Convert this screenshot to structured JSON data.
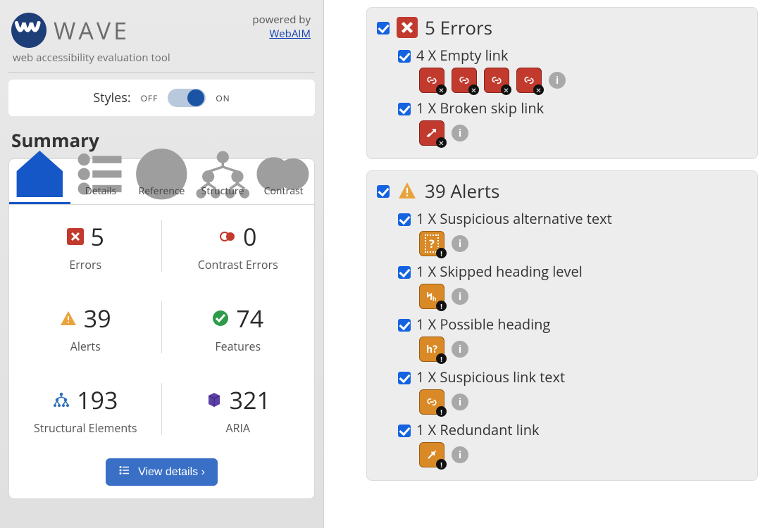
{
  "brand": {
    "title": "WAVE",
    "subtitle": "web accessibility evaluation tool",
    "powered_label": "powered by",
    "powered_link": "WebAIM"
  },
  "styles": {
    "label": "Styles:",
    "off": "OFF",
    "on": "ON"
  },
  "section": {
    "summary": "Summary"
  },
  "tabs": [
    "Summary",
    "Details",
    "Reference",
    "Structure",
    "Contrast"
  ],
  "stats": {
    "errors": {
      "value": "5",
      "label": "Errors"
    },
    "contrast": {
      "value": "0",
      "label": "Contrast Errors"
    },
    "alerts": {
      "value": "39",
      "label": "Alerts"
    },
    "features": {
      "value": "74",
      "label": "Features"
    },
    "structural": {
      "value": "193",
      "label": "Structural Elements"
    },
    "aria": {
      "value": "321",
      "label": "ARIA"
    }
  },
  "buttons": {
    "view_details": "View details ›"
  },
  "details": {
    "errors": {
      "heading": "5 Errors",
      "items": {
        "empty_link": {
          "label": "4 X Empty link",
          "count": 4
        },
        "broken_skip": {
          "label": "1 X Broken skip link"
        }
      }
    },
    "alerts": {
      "heading": "39 Alerts",
      "items": {
        "susp_alt": {
          "label": "1 X Suspicious alternative text",
          "glyph": "?"
        },
        "skip_head": {
          "label": "1 X Skipped heading level",
          "glyph": "h"
        },
        "poss_head": {
          "label": "1 X Possible heading",
          "glyph": "h?"
        },
        "susp_link": {
          "label": "1 X Suspicious link text"
        },
        "redund": {
          "label": "1 X Redundant link"
        }
      }
    }
  },
  "colors": {
    "error": "#c23a2e",
    "alert": "#e8a33c",
    "feature": "#2e9a4b",
    "structure": "#2e6fb7",
    "aria": "#5d3fa8"
  }
}
